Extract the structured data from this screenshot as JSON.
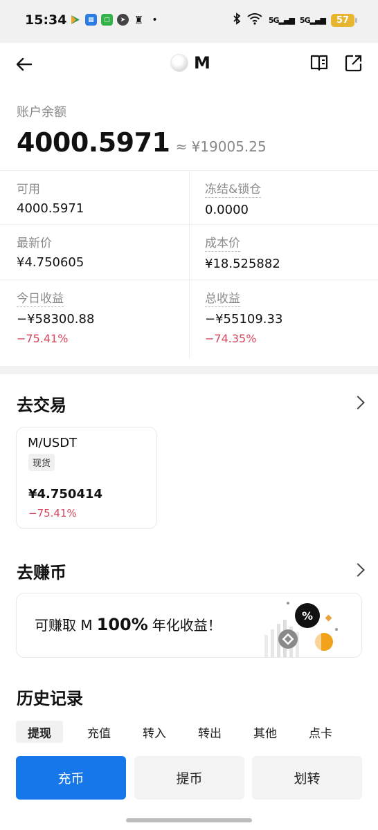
{
  "status_bar": {
    "time": "15:34",
    "battery": "57",
    "signal1": "5G",
    "signal2": "5G"
  },
  "header": {
    "title": "M"
  },
  "balance": {
    "label": "账户余额",
    "amount": "4000.5971",
    "approx": "≈ ¥19005.25"
  },
  "stats": [
    {
      "label": "可用",
      "value": "4000.5971"
    },
    {
      "label": "冻结&锁仓",
      "value": "0.0000"
    },
    {
      "label": "最新价",
      "value": "¥4.750605"
    },
    {
      "label": "成本价",
      "value": "¥18.525882"
    },
    {
      "label": "今日收益",
      "value": "−¥58300.88",
      "change": "−75.41%"
    },
    {
      "label": "总收益",
      "value": "−¥55109.33",
      "change": "−74.35%"
    }
  ],
  "trade": {
    "title": "去交易",
    "card": {
      "pair": "M/USDT",
      "tag": "现货",
      "price": "¥4.750414",
      "change": "−75.41%"
    }
  },
  "earn": {
    "title": "去赚币",
    "text_prefix": "可赚取 M",
    "percent": "100%",
    "text_suffix": "年化收益！",
    "badge": "%"
  },
  "history": {
    "title": "历史记录",
    "tabs": [
      "提现",
      "充值",
      "转入",
      "转出",
      "其他",
      "点卡"
    ]
  },
  "actions": {
    "deposit": "充币",
    "withdraw": "提币",
    "transfer": "划转"
  },
  "colors": {
    "primary": "#1677ea",
    "negative": "#d6455d",
    "battery": "#e8b530"
  }
}
